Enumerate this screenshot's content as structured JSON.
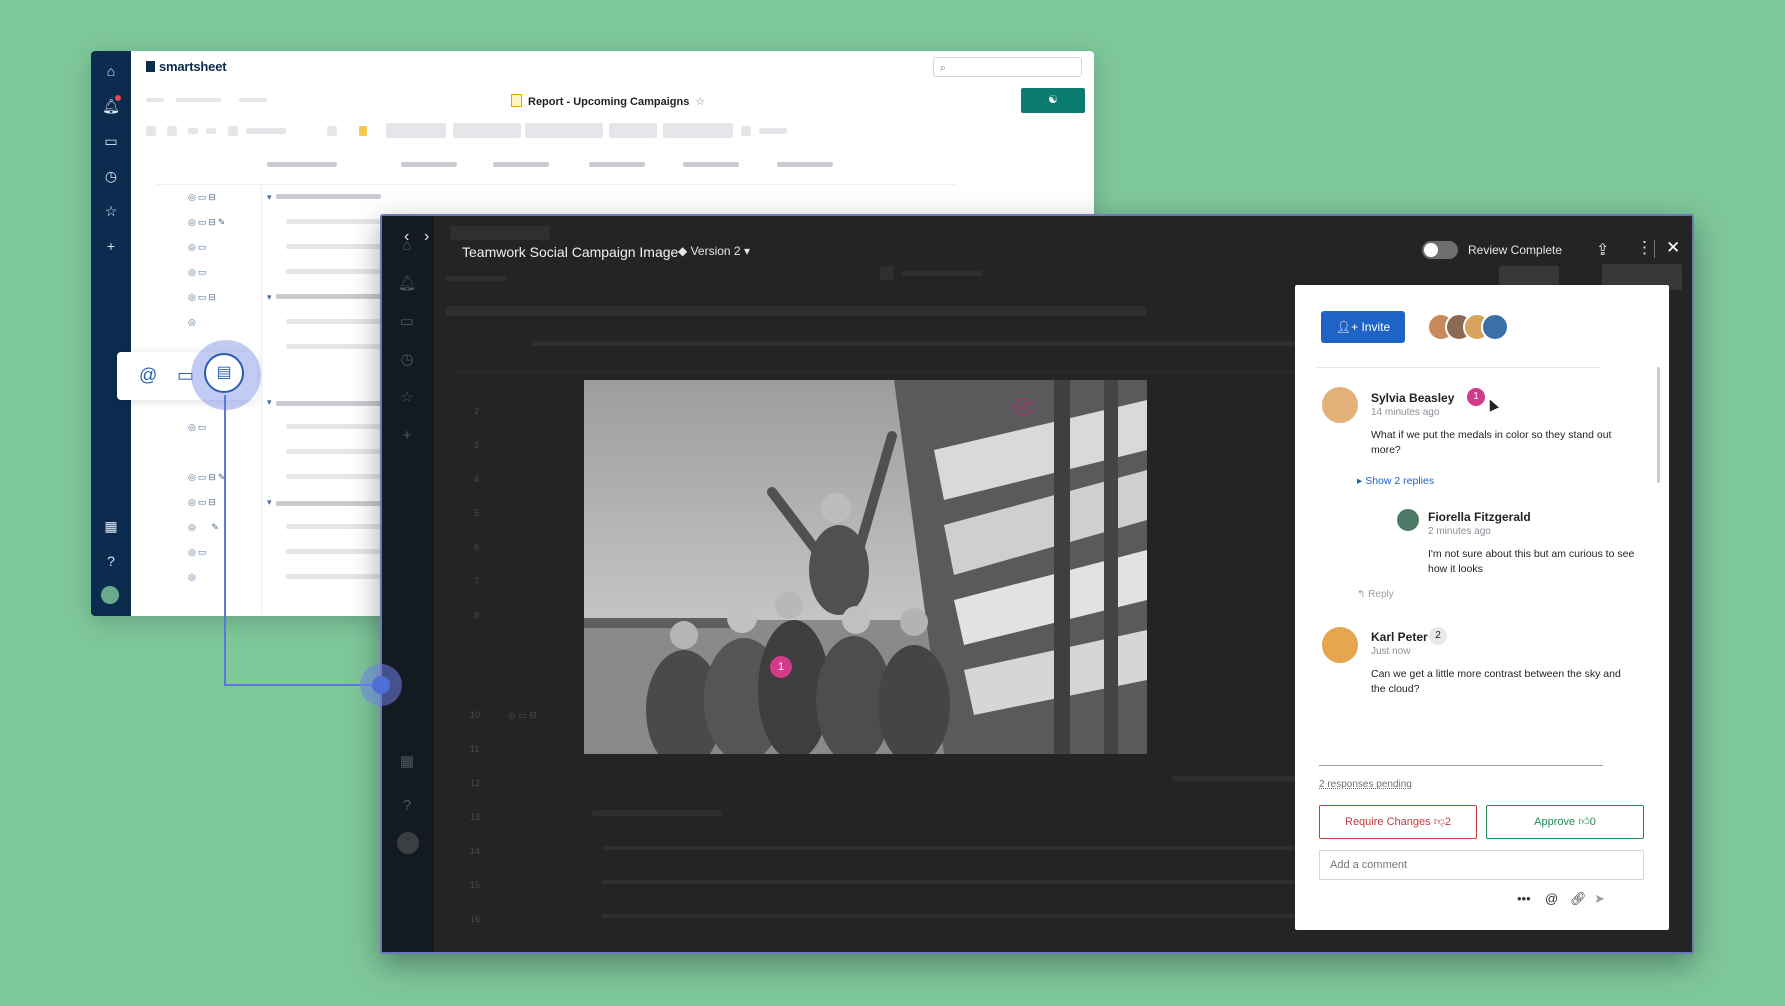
{
  "back_window": {
    "logo": "smartsheet",
    "report_title": "Report - Upcoming Campaigns",
    "star_glyph": "☆",
    "nav_icons": [
      "home-icon",
      "bell-icon",
      "folder-icon",
      "clock-icon",
      "star-icon",
      "plus-icon",
      "apps-icon",
      "help-icon",
      "avatar"
    ],
    "colors": {
      "nav": "#0b2b4f",
      "share_button": "#0a7c6f"
    }
  },
  "proof_window": {
    "title": "Teamwork Social Campaign Image",
    "version": "Version 2",
    "review_toggle_label": "Review Complete",
    "review_complete": false,
    "markers": [
      "1",
      "2"
    ]
  },
  "panel": {
    "invite_label": "Invite",
    "comments": [
      {
        "author": "Sylvia Beasley",
        "time": "14 minutes ago",
        "badge": "1",
        "text": "What if we put the medals in color so they stand out more?"
      },
      {
        "author": "Karl Peter",
        "time": "Just now",
        "badge": "2",
        "text": "Can we get a little more contrast between the sky and the cloud?"
      }
    ],
    "show_replies": "Show 2 replies",
    "reply": {
      "author": "Fiorella Fitzgerald",
      "time": "2 minutes ago",
      "text": "I'm not sure about this but am curious to see how it looks"
    },
    "reply_action": "Reply",
    "responses_pending": "2 responses pending",
    "require_changes": {
      "label": "Require Changes",
      "count": "2"
    },
    "approve": {
      "label": "Approve",
      "count": "0"
    },
    "comment_placeholder": "Add a comment",
    "colors": {
      "invite": "#1f63c6",
      "require": "#c23b3b",
      "approve": "#1f8a55",
      "marker": "#d23a8a"
    }
  }
}
